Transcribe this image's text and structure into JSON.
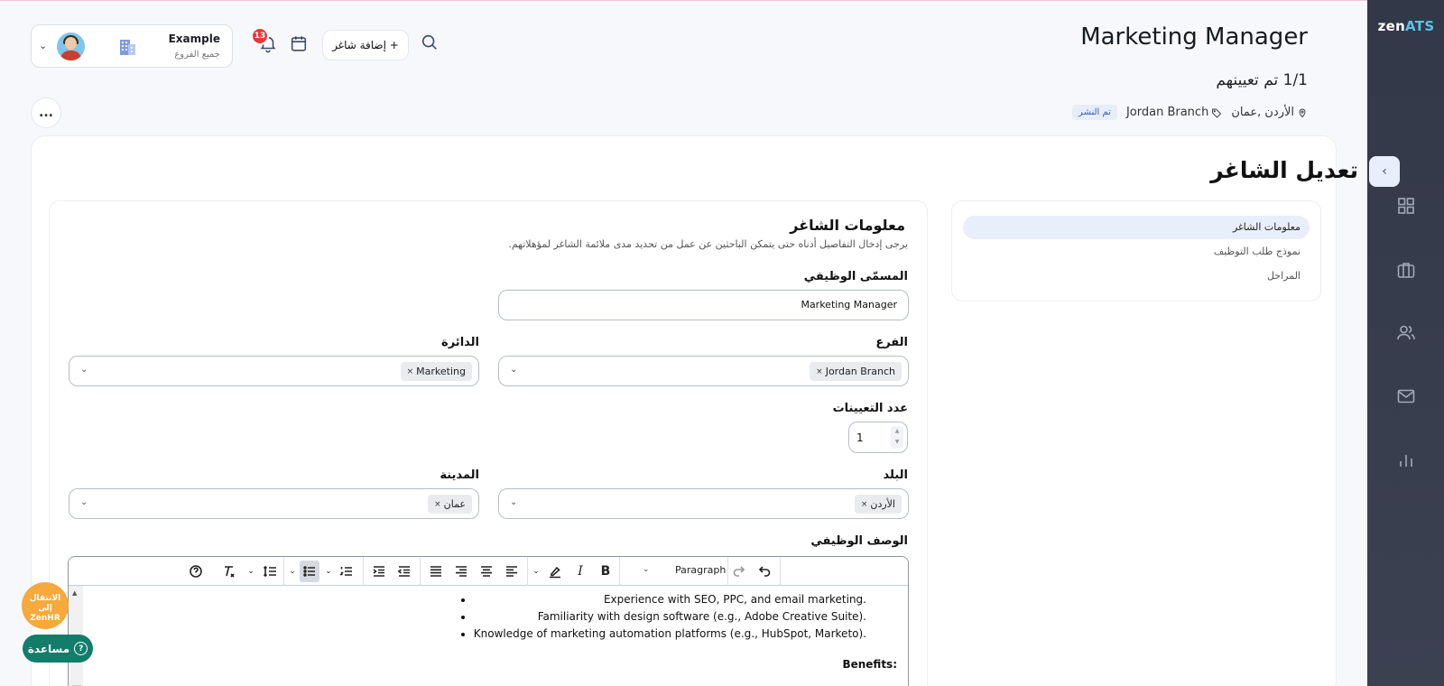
{
  "brand": {
    "zen": "zen",
    "ats": "ATS"
  },
  "sidebar": {
    "icons": [
      {
        "name": "dashboard-icon"
      },
      {
        "name": "briefcase-icon"
      },
      {
        "name": "users-icon"
      },
      {
        "name": "mail-icon"
      },
      {
        "name": "bar-chart-icon"
      }
    ]
  },
  "header": {
    "title": "Marketing Manager",
    "assigned": "1/1 تم تعيينهم",
    "location": "الأردن ,عمان",
    "branch": "Jordan Branch",
    "status_badge": "تم النشر",
    "more": "..."
  },
  "topbar": {
    "user_name": "Example",
    "user_sub": "جميع الفروع",
    "notifications_count": "13",
    "add_button": "+ إضافة شاغر"
  },
  "edit": {
    "title": "تعديل الشاغر",
    "menu": [
      "معلومات الشاغر",
      "نموذج طلب التوظيف",
      "المراحل"
    ]
  },
  "form": {
    "section_title": "معلومات الشاغر",
    "section_desc": "يرجى إدخال التفاصيل أدناه حتى يتمكن الباحثين عن عمل من تحديد مدى ملائمة الشاغر لمؤهلاتهم.",
    "job_title_label": "المسمّى الوظيفي",
    "job_title_value": "Marketing Manager",
    "branch_label": "الفرع",
    "branch_value": "Jordan Branch",
    "department_label": "الدائرة",
    "department_value": "Marketing",
    "openings_label": "عدد التعيينات",
    "openings_value": "1",
    "country_label": "البلد",
    "country_value": "الأردن",
    "city_label": "المدينة",
    "city_value": "عمان",
    "description_label": "الوصف الوظيفي"
  },
  "editor": {
    "paragraph": "Paragraph",
    "bold": "B",
    "italic": "I",
    "items": [
      "Experience with SEO, PPC, and email marketing.",
      "Familiarity with design software (e.g., Adobe Creative Suite).",
      "Knowledge of marketing automation platforms (e.g., HubSpot, Marketo)."
    ],
    "benefits": "Benefits:"
  },
  "floating": {
    "zenhr_line1": "الانتقال إلى",
    "zenhr_line2": "ZenHR",
    "help": "مساعدة"
  }
}
